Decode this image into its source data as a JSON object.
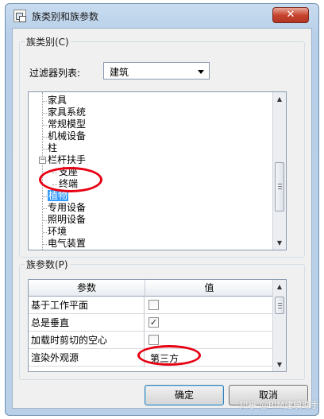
{
  "window": {
    "title": "族类别和族参数",
    "close_glyph": "✕"
  },
  "category_group": {
    "title": "族类别(C)",
    "filter_label": "过滤器列表:",
    "filter_value": "建筑",
    "tree_items": [
      {
        "label": "家具",
        "indent": 1
      },
      {
        "label": "家具系统",
        "indent": 1
      },
      {
        "label": "常规模型",
        "indent": 1
      },
      {
        "label": "机械设备",
        "indent": 1
      },
      {
        "label": "柱",
        "indent": 1
      },
      {
        "label": "栏杆扶手",
        "indent": 1,
        "expander": "−"
      },
      {
        "label": "支座",
        "indent": 2
      },
      {
        "label": "终端",
        "indent": 2
      },
      {
        "label": "植物",
        "indent": 1,
        "selected": true
      },
      {
        "label": "专用设备",
        "indent": 1
      },
      {
        "label": "照明设备",
        "indent": 1
      },
      {
        "label": "环境",
        "indent": 1
      },
      {
        "label": "电气装置",
        "indent": 1
      }
    ]
  },
  "params_group": {
    "title": "族参数(P)",
    "columns": [
      "参数",
      "值"
    ],
    "rows": [
      {
        "name": "基于工作平面",
        "type": "checkbox",
        "checked": false
      },
      {
        "name": "总是垂直",
        "type": "checkbox",
        "checked": true
      },
      {
        "name": "加载时剪切的空心",
        "type": "checkbox",
        "checked": false
      },
      {
        "name": "渲染外观源",
        "type": "text",
        "value": "第三方"
      }
    ]
  },
  "buttons": {
    "ok": "确定",
    "cancel": "取消"
  },
  "watermark": "知乎 @BIM建模助手",
  "colors": {
    "highlight": "#e60012",
    "selection": "#3399ff",
    "frame": "#b9d0e8"
  }
}
